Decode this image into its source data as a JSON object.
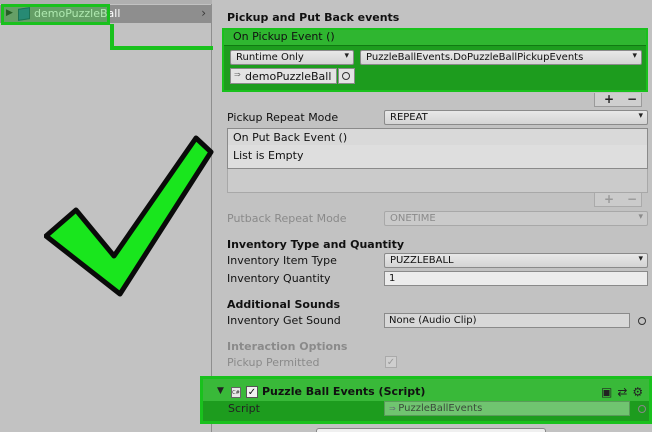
{
  "hierarchy": {
    "selected_item": "demoPuzzleBall"
  },
  "pickup_section": {
    "title": "Pickup and Put Back events",
    "on_pickup_event": {
      "header": "On Pickup Event ()",
      "runtime": "Runtime Only",
      "function": "PuzzleBallEvents.DoPuzzleBallPickupEvents",
      "object": "demoPuzzleBall"
    },
    "pickup_repeat_mode_label": "Pickup Repeat Mode",
    "pickup_repeat_mode_value": "REPEAT",
    "on_put_back_event": {
      "header": "On Put Back Event ()",
      "empty_text": "List is Empty"
    },
    "putback_repeat_mode_label": "Putback Repeat Mode",
    "putback_repeat_mode_value": "ONETIME",
    "plus": "+",
    "minus": "−"
  },
  "inventory": {
    "title": "Inventory Type and Quantity",
    "item_type_label": "Inventory Item Type",
    "item_type_value": "PUZZLEBALL",
    "quantity_label": "Inventory Quantity",
    "quantity_value": "1"
  },
  "sounds": {
    "title": "Additional Sounds",
    "get_sound_label": "Inventory Get Sound",
    "get_sound_value": "None (Audio Clip)"
  },
  "interaction": {
    "title": "Interaction Options",
    "pickup_permitted_label": "Pickup Permitted"
  },
  "script_component": {
    "title": "Puzzle Ball Events (Script)",
    "script_label": "Script",
    "script_value": "PuzzleBallEvents",
    "icon_text": "C#"
  },
  "colors": {
    "highlight": "#19c11d",
    "highlight_dark": "#1d9c1e",
    "panel_bg": "#c2c2c2"
  },
  "icons": [
    "expand-arrow-icon",
    "gameobject-cube-icon",
    "dropdown-caret-icon",
    "object-picker-icon",
    "checkmark-icon",
    "script-file-icon",
    "help-book-icon",
    "preset-icon",
    "gear-icon"
  ]
}
